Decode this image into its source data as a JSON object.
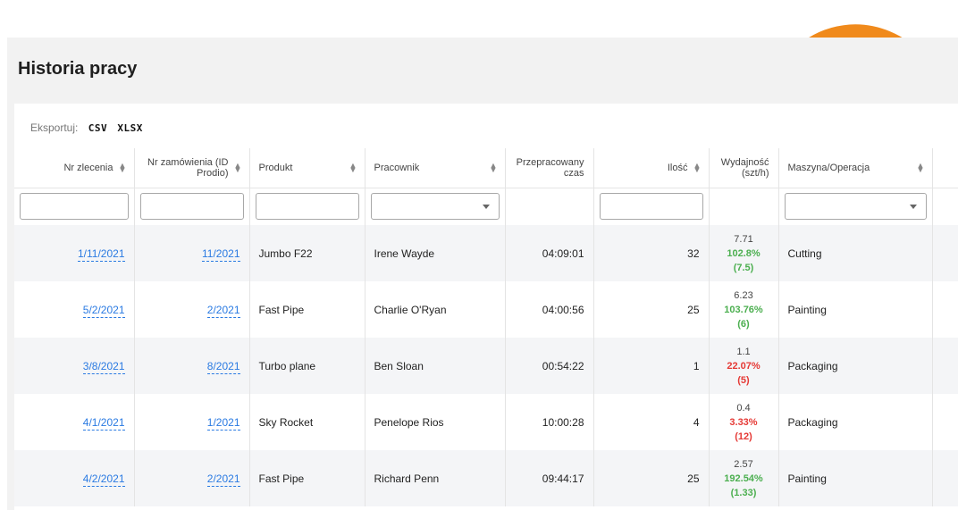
{
  "page": {
    "title": "Historia pracy"
  },
  "export": {
    "label": "Eksportuj:",
    "formats": [
      "CSV",
      "XLSX"
    ]
  },
  "columns": [
    "Nr zlecenia",
    "Nr zamówienia (ID Prodio)",
    "Produkt",
    "Pracownik",
    "Przepracowany czas",
    "Ilość",
    "Wydajność (szt/h)",
    "Maszyna/Operacja"
  ],
  "rows": [
    {
      "order": "1/11/2021",
      "prodio_id": "11/2021",
      "product": "Jumbo F22",
      "worker": "Irene Wayde",
      "time": "04:09:01",
      "qty": "32",
      "eff_value": "7.71",
      "eff_pct": "102.8%",
      "eff_norm": "(7.5)",
      "eff_status": "good",
      "machine": "Cutting"
    },
    {
      "order": "5/2/2021",
      "prodio_id": "2/2021",
      "product": "Fast Pipe",
      "worker": "Charlie O'Ryan",
      "time": "04:00:56",
      "qty": "25",
      "eff_value": "6.23",
      "eff_pct": "103.76%",
      "eff_norm": "(6)",
      "eff_status": "good",
      "machine": "Painting"
    },
    {
      "order": "3/8/2021",
      "prodio_id": "8/2021",
      "product": "Turbo plane",
      "worker": "Ben Sloan",
      "time": "00:54:22",
      "qty": "1",
      "eff_value": "1.1",
      "eff_pct": "22.07%",
      "eff_norm": "(5)",
      "eff_status": "bad",
      "machine": "Packaging"
    },
    {
      "order": "4/1/2021",
      "prodio_id": "1/2021",
      "product": "Sky Rocket",
      "worker": "Penelope Rios",
      "time": "10:00:28",
      "qty": "4",
      "eff_value": "0.4",
      "eff_pct": "3.33%",
      "eff_norm": "(12)",
      "eff_status": "bad",
      "machine": "Packaging"
    },
    {
      "order": "4/2/2021",
      "prodio_id": "2/2021",
      "product": "Fast Pipe",
      "worker": "Richard Penn",
      "time": "09:44:17",
      "qty": "25",
      "eff_value": "2.57",
      "eff_pct": "192.54%",
      "eff_norm": "(1.33)",
      "eff_status": "good",
      "machine": "Painting"
    }
  ],
  "colors": {
    "link": "#2a7ae2",
    "good": "#4caf50",
    "bad": "#e53935",
    "arrow": "#f08a1c"
  }
}
